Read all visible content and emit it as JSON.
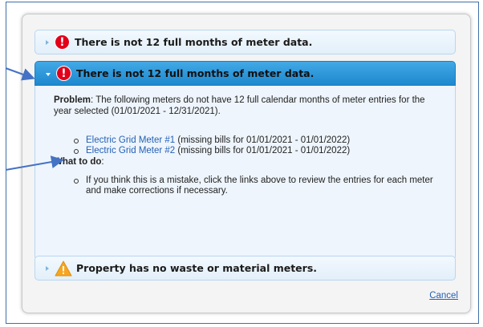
{
  "panels": [
    {
      "title": "There is not 12 full months of meter data.",
      "icon": "alert-icon",
      "state": "collapsed"
    },
    {
      "title": "There is not 12 full months of meter data.",
      "icon": "alert-icon",
      "state": "expanded"
    },
    {
      "title": "Property has no waste or material meters.",
      "icon": "warning-icon",
      "state": "collapsed"
    }
  ],
  "alert_glyph": "!",
  "problem": {
    "label": "Problem",
    "text": ": The following meters do not have 12 full calendar months of meter entries for the year selected (01/01/2021 - 12/31/2021)."
  },
  "meters": [
    {
      "name": "Electric Grid Meter #1",
      "note": " (missing bills for 01/01/2021 - 01/01/2022)"
    },
    {
      "name": "Electric Grid Meter #2",
      "note": " (missing bills for 01/01/2021 - 01/01/2022)"
    }
  ],
  "what_to_do": {
    "label": "What to do",
    "colon": ":",
    "items": [
      "If you think this is a mistake, click the links above to review the entries for each meter and make corrections if necessary."
    ]
  },
  "cancel_label": "Cancel",
  "colors": {
    "accent": "#1d88cf",
    "link": "#2460b7",
    "alert": "#e2001a",
    "warning": "#f5a623",
    "annotation_arrow": "#4472c4"
  }
}
